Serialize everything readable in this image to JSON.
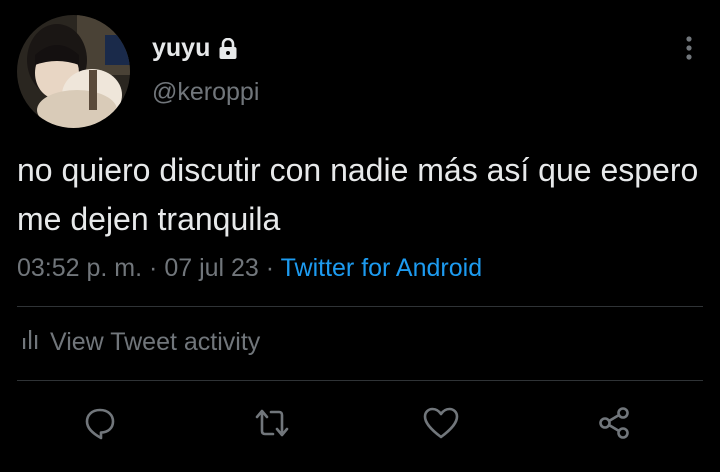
{
  "user": {
    "display_name": "yuyu",
    "handle": "@keroppi",
    "protected": true
  },
  "tweet": {
    "text": "no quiero discutir con nadie más así que espero me dejen tranquila",
    "time": "03:52 p. m.",
    "separator1": "·",
    "date": "07 jul 23",
    "separator2": "·",
    "source": "Twitter for Android"
  },
  "activity": {
    "label": "View Tweet activity"
  },
  "actions": [
    {
      "name": "reply",
      "icon": "reply-icon"
    },
    {
      "name": "retweet",
      "icon": "retweet-icon"
    },
    {
      "name": "like",
      "icon": "heart-icon"
    },
    {
      "name": "share",
      "icon": "share-icon"
    }
  ],
  "colors": {
    "background": "#000000",
    "primary_text": "#e7e9ea",
    "secondary_text": "#71767b",
    "link": "#1d9bf0",
    "divider": "#2f3336"
  }
}
